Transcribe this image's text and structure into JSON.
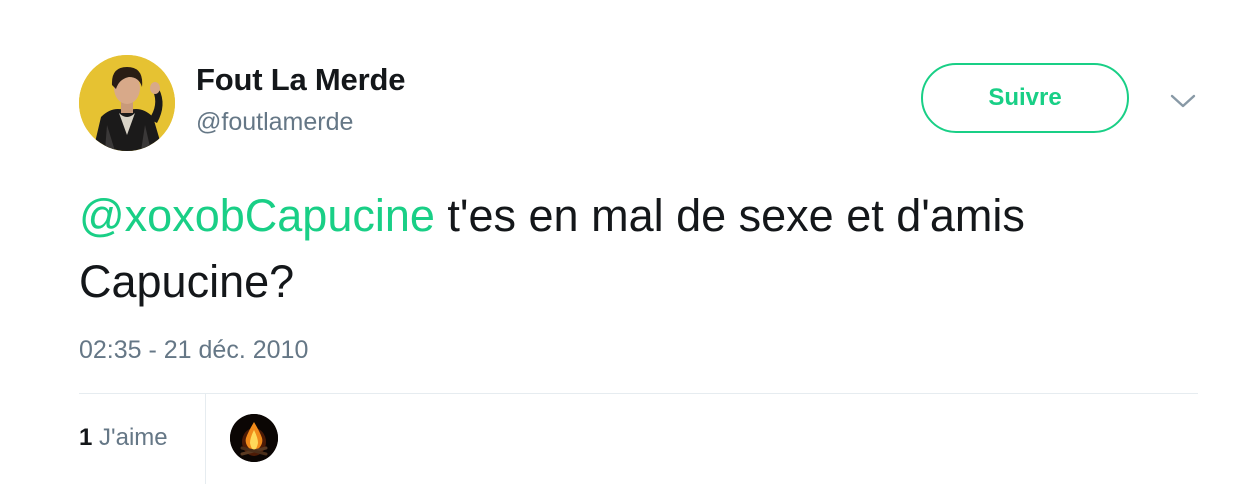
{
  "author": {
    "name": "Fout La Merde",
    "handle": "@foutlamerde",
    "avatar_icon": "profile-photo-man-leather-jacket"
  },
  "follow_button": {
    "label": "Suivre"
  },
  "menu_icon": "chevron-down-icon",
  "tweet": {
    "mention": "@xoxobCapucine",
    "text": " t'es en mal de sexe et d'amis Capucine?",
    "timestamp": "02:35 - 21 déc. 2010"
  },
  "stats": {
    "likes_count": "1",
    "likes_label": "J'aime",
    "liker_avatar_icon": "campfire-icon"
  },
  "colors": {
    "accent": "#19cf86",
    "text": "#14171a",
    "secondary": "#657786",
    "divider": "#e6ecf0"
  }
}
